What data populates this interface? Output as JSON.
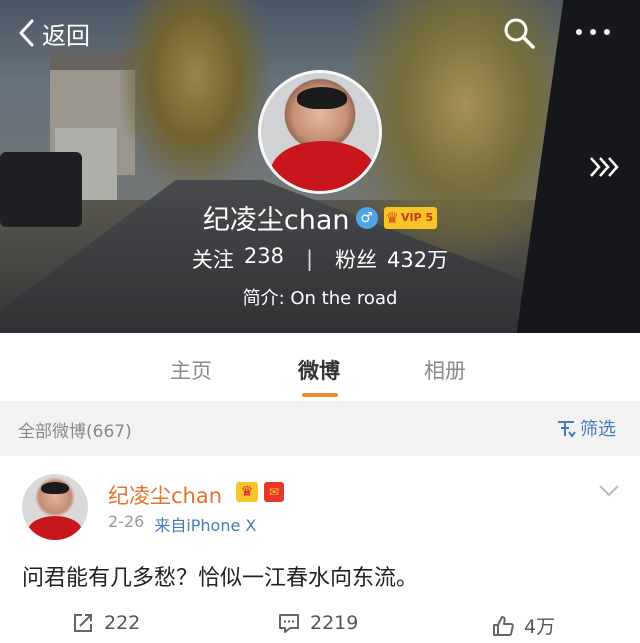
{
  "header": {
    "back_label": "返回",
    "profile_name": "纪凌尘chan",
    "gender_symbol": "♂",
    "vip_label": "VIP 5",
    "following_label": "关注",
    "following_count": "238",
    "separator": "|",
    "followers_label": "粉丝",
    "followers_count": "432万",
    "bio": "简介: On the road"
  },
  "tabs": [
    {
      "label": "主页",
      "active": false
    },
    {
      "label": "微博",
      "active": true
    },
    {
      "label": "相册",
      "active": false
    }
  ],
  "filter_bar": {
    "all_posts": "全部微博(667)",
    "filter_label": "筛选"
  },
  "post": {
    "author": "纪凌尘chan",
    "date": "2-26",
    "source": "来自iPhone X",
    "text": "问君能有几多愁？恰似一江春水向东流。",
    "repost_count": "222",
    "comment_count": "2219",
    "like_count": "4万"
  },
  "colors": {
    "accent_orange": "#f08a24",
    "link_blue": "#4a7ab7",
    "author_orange": "#e8712b"
  },
  "icons": [
    "back-chevron-icon",
    "search-icon",
    "more-icon",
    "forward-arrows-icon",
    "gender-male-icon",
    "vip-crown-icon",
    "filter-icon",
    "chevron-down-icon",
    "repost-icon",
    "comment-icon",
    "like-icon"
  ]
}
